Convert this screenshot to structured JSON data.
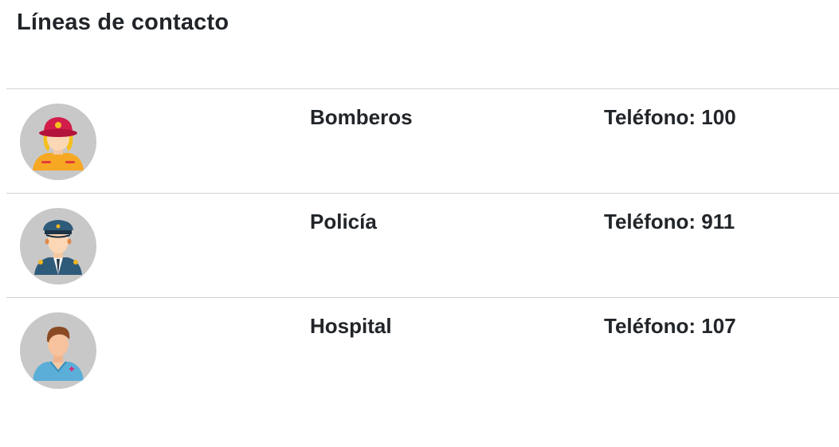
{
  "page": {
    "title": "Líneas de contacto"
  },
  "contacts": [
    {
      "name": "Bomberos",
      "phone_label": "Teléfono:",
      "phone": "100",
      "icon": "firefighter-icon"
    },
    {
      "name": "Policía",
      "phone_label": "Teléfono:",
      "phone": "911",
      "icon": "police-officer-icon"
    },
    {
      "name": "Hospital",
      "phone_label": "Teléfono:",
      "phone": "107",
      "icon": "doctor-icon"
    }
  ],
  "colors": {
    "avatar_bg": "#c8c8c8",
    "divider": "#cfd3d6",
    "text": "#212529"
  }
}
